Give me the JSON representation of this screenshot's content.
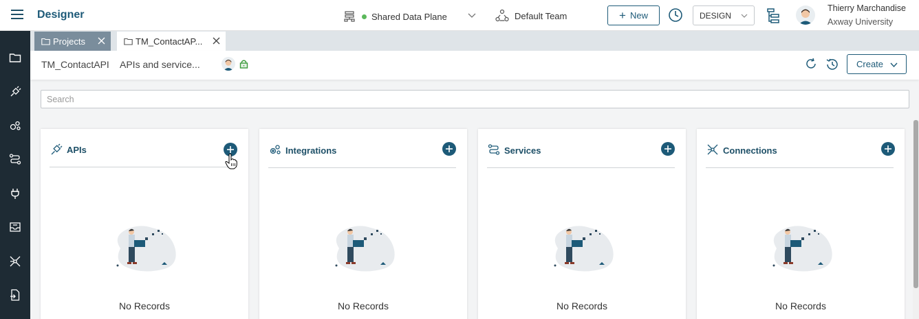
{
  "header": {
    "brand": "Designer",
    "data_plane": "Shared Data Plane",
    "team": "Default Team",
    "new_label": "New",
    "mode": "DESIGN",
    "user_name": "Thierry Marchandise",
    "user_org": "Axway University",
    "status_color": "#5cb85c"
  },
  "sidebar": {
    "items": [
      {
        "icon": "folder-icon"
      },
      {
        "icon": "api-plug-icon"
      },
      {
        "icon": "integrations-gears-icon"
      },
      {
        "icon": "services-icon"
      },
      {
        "icon": "power-plug-icon"
      },
      {
        "icon": "inbox-icon"
      },
      {
        "icon": "connections-icon"
      },
      {
        "icon": "export-file-icon"
      }
    ]
  },
  "tabs": [
    {
      "label": "Projects",
      "active": false
    },
    {
      "label": "TM_ContactAP...",
      "active": true
    }
  ],
  "subheader": {
    "project_name": "TM_ContactAPI",
    "description": "APIs and service...",
    "create_label": "Create"
  },
  "search": {
    "placeholder": "Search"
  },
  "cards": [
    {
      "title": "APIs",
      "empty": "No Records",
      "icon": "api-plug-icon"
    },
    {
      "title": "Integrations",
      "empty": "No Records",
      "icon": "integrations-gears-icon"
    },
    {
      "title": "Services",
      "empty": "No Records",
      "icon": "services-icon"
    },
    {
      "title": "Connections",
      "empty": "No Records",
      "icon": "connections-icon"
    }
  ],
  "colors": {
    "accent": "#1d5a78",
    "sidebar": "#1e2b34",
    "tab_inactive": "#7a8d9c"
  }
}
